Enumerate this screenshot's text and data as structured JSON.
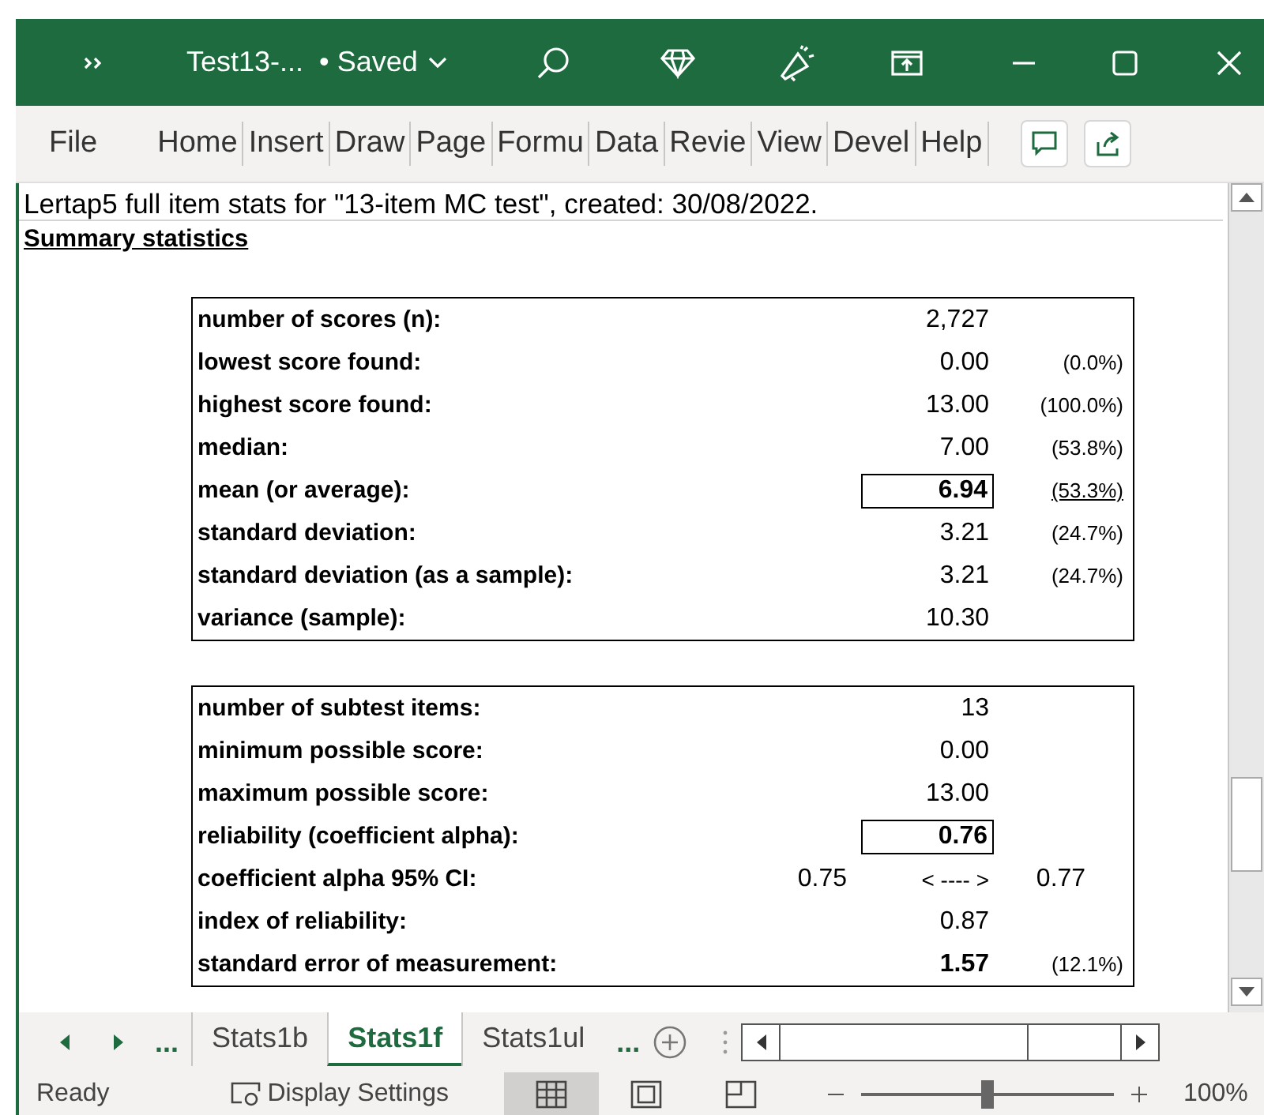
{
  "window": {
    "title": "Test13-...",
    "save_status": "• Saved"
  },
  "ribbon": {
    "tabs": [
      {
        "label": "File"
      },
      {
        "label": "Home"
      },
      {
        "label": "Insert"
      },
      {
        "label": "Draw"
      },
      {
        "label": "Page"
      },
      {
        "label": "Formu"
      },
      {
        "label": "Data"
      },
      {
        "label": "Revie"
      },
      {
        "label": "View"
      },
      {
        "label": "Devel"
      },
      {
        "label": "Help"
      }
    ]
  },
  "sheet": {
    "caption": "Lertap5 full item stats for \"13-item MC test\", created: 30/08/2022.",
    "heading": "Summary statistics",
    "tables": [
      {
        "rows": [
          {
            "kind": "stat",
            "label": "number of scores (n):",
            "value": "2,727",
            "bold": false,
            "boxed": false
          },
          {
            "kind": "stat",
            "label": "lowest score found:",
            "value": "0.00",
            "bold": false,
            "boxed": false,
            "percent": "(0.0%)",
            "underlined": false
          },
          {
            "kind": "stat",
            "label": "highest score found:",
            "value": "13.00",
            "bold": false,
            "boxed": false,
            "percent": "(100.0%)",
            "underlined": false
          },
          {
            "kind": "stat",
            "label": "median:",
            "value": "7.00",
            "bold": false,
            "boxed": false,
            "percent": "(53.8%)",
            "underlined": false
          },
          {
            "kind": "stat",
            "label": "mean (or average):",
            "value": "6.94",
            "bold": true,
            "boxed": true,
            "percent": "(53.3%)",
            "underlined": true
          },
          {
            "kind": "stat",
            "label": "standard deviation:",
            "value": "3.21",
            "bold": false,
            "boxed": false,
            "percent": "(24.7%)",
            "underlined": false
          },
          {
            "kind": "stat",
            "label": "standard deviation (as a sample):",
            "value": "3.21",
            "bold": false,
            "boxed": false,
            "percent": "(24.7%)",
            "underlined": false
          },
          {
            "kind": "stat",
            "label": "variance (sample):",
            "value": "10.30",
            "bold": false,
            "boxed": false
          }
        ]
      },
      {
        "rows": [
          {
            "kind": "stat",
            "label": "number of subtest items:",
            "value": "13",
            "bold": false,
            "boxed": false
          },
          {
            "kind": "stat",
            "label": "minimum possible score:",
            "value": "0.00",
            "bold": false,
            "boxed": false
          },
          {
            "kind": "stat",
            "label": "maximum possible score:",
            "value": "13.00",
            "bold": false,
            "boxed": false
          },
          {
            "kind": "stat",
            "label": "reliability (coefficient alpha):",
            "value": "0.76",
            "bold": true,
            "boxed": true
          },
          {
            "kind": "interval",
            "label": "coefficient alpha 95% CI:",
            "low": "0.75",
            "arrow": "< ---- >",
            "high": "0.77"
          },
          {
            "kind": "stat",
            "label": "index of reliability:",
            "value": "0.87",
            "bold": false,
            "boxed": false
          },
          {
            "kind": "stat",
            "label": "standard error of measurement:",
            "value": "1.57",
            "bold": true,
            "boxed": false,
            "percent": "(12.1%)",
            "underlined": false
          }
        ]
      }
    ]
  },
  "sheet_tabs": {
    "more_left": "...",
    "tabs": [
      {
        "label": "Stats1b",
        "selected": false
      },
      {
        "label": "Stats1f",
        "selected": true
      },
      {
        "label": "Stats1ul",
        "selected": false
      }
    ],
    "more_right": "..."
  },
  "status_bar": {
    "status": "Ready",
    "display_settings": "Display Settings",
    "views": [
      {
        "kind": "normal",
        "selected": true
      },
      {
        "kind": "page-layout",
        "selected": false
      },
      {
        "kind": "page-break",
        "selected": false
      }
    ],
    "zoom": {
      "level": 0.5,
      "reading": "100%"
    }
  }
}
